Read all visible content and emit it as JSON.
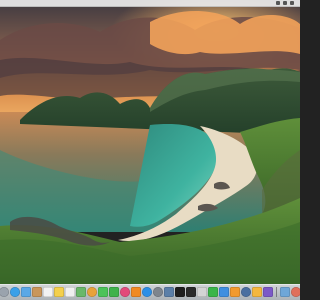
{
  "desktop": {
    "wallpaper": "coastal-bay-sunset-wallpaper"
  },
  "menubar": {
    "icons": [
      "status-icon",
      "status-icon",
      "status-icon"
    ]
  },
  "dock": {
    "apps": [
      {
        "name": "finder-icon",
        "color": "#2f7fe0",
        "shape": "square"
      },
      {
        "name": "launchpad-icon",
        "color": "#9aa3ad",
        "shape": "round"
      },
      {
        "name": "safari-icon",
        "color": "#3aa0e8",
        "shape": "round"
      },
      {
        "name": "mail-icon",
        "color": "#5aa8e6",
        "shape": "square"
      },
      {
        "name": "contacts-icon",
        "color": "#c9965a",
        "shape": "square"
      },
      {
        "name": "calendar-icon",
        "color": "#f2f2f2",
        "shape": "square"
      },
      {
        "name": "notes-icon",
        "color": "#f4d04c",
        "shape": "square"
      },
      {
        "name": "reminders-icon",
        "color": "#f0f0f0",
        "shape": "square"
      },
      {
        "name": "maps-icon",
        "color": "#6ab86a",
        "shape": "square"
      },
      {
        "name": "photos-icon",
        "color": "#e8a23a",
        "shape": "round"
      },
      {
        "name": "messages-icon",
        "color": "#4cc35a",
        "shape": "square"
      },
      {
        "name": "facetime-icon",
        "color": "#3fb24c",
        "shape": "square"
      },
      {
        "name": "itunes-icon",
        "color": "#e24a7a",
        "shape": "round"
      },
      {
        "name": "ibooks-icon",
        "color": "#f08a24",
        "shape": "square"
      },
      {
        "name": "app-store-icon",
        "color": "#2b8fe6",
        "shape": "round"
      },
      {
        "name": "system-preferences-icon",
        "color": "#7d858d",
        "shape": "round"
      },
      {
        "name": "preview-icon",
        "color": "#5b7fa8",
        "shape": "square"
      },
      {
        "name": "terminal-icon",
        "color": "#1e1e1e",
        "shape": "square"
      },
      {
        "name": "activity-monitor-icon",
        "color": "#2a2a2a",
        "shape": "square"
      },
      {
        "name": "grapher-icon",
        "color": "#d4d4d4",
        "shape": "square"
      },
      {
        "name": "numbers-icon",
        "color": "#3bb54a",
        "shape": "square"
      },
      {
        "name": "keynote-icon",
        "color": "#3f8fe0",
        "shape": "square"
      },
      {
        "name": "pages-icon",
        "color": "#f29a2e",
        "shape": "square"
      },
      {
        "name": "quicktime-icon",
        "color": "#4a6fa0",
        "shape": "round"
      },
      {
        "name": "garageband-icon",
        "color": "#f4b73e",
        "shape": "square"
      },
      {
        "name": "imovie-icon",
        "color": "#7b59c7",
        "shape": "square"
      }
    ],
    "trailing": [
      {
        "name": "downloads-stack-icon",
        "color": "#6fa7d8",
        "shape": "square"
      },
      {
        "name": "folder-stack-icon",
        "color": "#e06f5a",
        "shape": "round"
      },
      {
        "name": "trash-icon",
        "color": "#c9ced3",
        "shape": "square"
      }
    ]
  }
}
